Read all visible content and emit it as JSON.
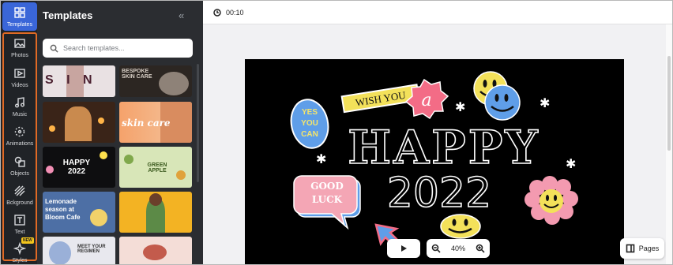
{
  "rail": {
    "items": [
      {
        "label": "Templates",
        "icon": "templates-icon"
      },
      {
        "label": "Photos",
        "icon": "photo-icon"
      },
      {
        "label": "Videos",
        "icon": "video-icon"
      },
      {
        "label": "Music",
        "icon": "music-icon"
      },
      {
        "label": "Animations",
        "icon": "animation-icon"
      },
      {
        "label": "Objects",
        "icon": "objects-icon"
      },
      {
        "label": "Bckground",
        "icon": "background-icon"
      },
      {
        "label": "Text",
        "icon": "text-icon"
      },
      {
        "label": "Styles",
        "icon": "styles-icon"
      }
    ],
    "new_badge": "NEW",
    "highlight_color": "#e06a25",
    "active_color": "#3a66d8"
  },
  "panel": {
    "title": "Templates",
    "collapse_glyph": "«",
    "search_placeholder": "Search templates...",
    "thumbs": [
      {
        "text": "S  I  N",
        "color": "#4a1f2f"
      },
      {
        "text": "BESPOKE SKIN CARE",
        "color": "#5a4a3e"
      },
      {
        "text": "",
        "color": "#2a1a12"
      },
      {
        "text": "skin care",
        "color": "#ffffff"
      },
      {
        "text": "HAPPY 2022",
        "color": "#ffffff"
      },
      {
        "text": "GREEN APPLE",
        "color": "#3b5a1e"
      },
      {
        "text": "Lemonade season at Bloom Cafe",
        "color": "#ffffff"
      },
      {
        "text": "",
        "color": "#fff"
      },
      {
        "text": "MEET YOUR REGIMEN",
        "color": "#333"
      },
      {
        "text": "",
        "color": "#333"
      }
    ]
  },
  "topbar": {
    "time": "00:10"
  },
  "canvas_text": {
    "wish": "WISH YOU",
    "a": "a",
    "yes1": "YES",
    "yes2": "YOU",
    "yes3": "CAN",
    "happy": "HAPPY",
    "year": "2022",
    "good": "GOOD",
    "luck": "LUCK"
  },
  "controls": {
    "zoom": "40%",
    "pages_label": "Pages"
  }
}
